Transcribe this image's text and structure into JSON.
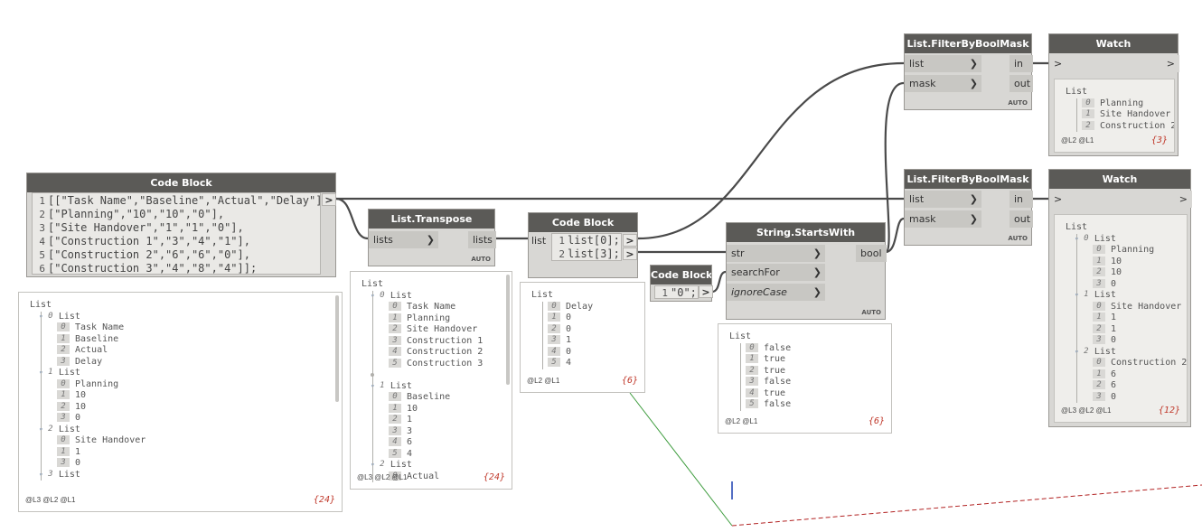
{
  "nodes": {
    "code_main": {
      "title": "Code Block",
      "lines": [
        {
          "n": "1",
          "t": "[[\"Task Name\",\"Baseline\",\"Actual\",\"Delay\"],"
        },
        {
          "n": "2",
          "t": "[\"Planning\",\"10\",\"10\",\"0\"],"
        },
        {
          "n": "3",
          "t": "[\"Site Handover\",\"1\",\"1\",\"0\"],"
        },
        {
          "n": "4",
          "t": "[\"Construction 1\",\"3\",\"4\",\"1\"],"
        },
        {
          "n": "5",
          "t": "[\"Construction 2\",\"6\",\"6\",\"0\"],"
        },
        {
          "n": "6",
          "t": "[\"Construction 3\",\"4\",\"8\",\"4\"]];"
        }
      ],
      "out": ">"
    },
    "transpose": {
      "title": "List.Transpose",
      "in_lists": "lists",
      "out_lists": "lists",
      "auto": "AUTO"
    },
    "code_index": {
      "title": "Code Block",
      "in": "list",
      "lines": [
        {
          "n": "1",
          "t": "list[0];"
        },
        {
          "n": "2",
          "t": "list[3];"
        }
      ],
      "out": ">"
    },
    "code_zero": {
      "title": "Code Block",
      "line_n": "1",
      "line_t": "\"0\";",
      "out": ">"
    },
    "startswith": {
      "title": "String.StartsWith",
      "in_str": "str",
      "in_search": "searchFor",
      "in_ignore": "ignoreCase",
      "out_bool": "bool",
      "auto": "AUTO"
    },
    "filter_top": {
      "title": "List.FilterByBoolMask",
      "in_list": "list",
      "in_mask": "mask",
      "out_in": "in",
      "out_out": "out",
      "auto": "AUTO"
    },
    "filter_bottom": {
      "title": "List.FilterByBoolMask",
      "in_list": "list",
      "in_mask": "mask",
      "out_in": "in",
      "out_out": "out",
      "auto": "AUTO"
    },
    "watch_top": {
      "title": "Watch",
      "in": ">",
      "out": ">"
    },
    "watch_bottom": {
      "title": "Watch",
      "in": ">",
      "out": ">"
    }
  },
  "previews": {
    "code_main": {
      "levels": "@L3 @L2 @L1",
      "count": "{24}",
      "rows": [
        {
          "d": 0,
          "t": "List"
        },
        {
          "d": 1,
          "i": "0",
          "t": "List",
          "g": true
        },
        {
          "d": 2,
          "i": "0",
          "t": "Task Name"
        },
        {
          "d": 2,
          "i": "1",
          "t": "Baseline"
        },
        {
          "d": 2,
          "i": "2",
          "t": "Actual"
        },
        {
          "d": 2,
          "i": "3",
          "t": "Delay"
        },
        {
          "d": 1,
          "i": "1",
          "t": "List",
          "g": true
        },
        {
          "d": 2,
          "i": "0",
          "t": "Planning"
        },
        {
          "d": 2,
          "i": "1",
          "t": "10"
        },
        {
          "d": 2,
          "i": "2",
          "t": "10"
        },
        {
          "d": 2,
          "i": "3",
          "t": "0"
        },
        {
          "d": 1,
          "i": "2",
          "t": "List",
          "g": true
        },
        {
          "d": 2,
          "i": "0",
          "t": "Site Handover"
        },
        {
          "d": 2,
          "i": "1",
          "t": "1"
        },
        {
          "d": 2,
          "i": "3",
          "t": "0"
        },
        {
          "d": 1,
          "i": "3",
          "t": "List",
          "g": true
        }
      ]
    },
    "transpose": {
      "levels": "@L3 @L2 @L1",
      "count": "{24}",
      "rows": [
        {
          "d": 0,
          "t": "List"
        },
        {
          "d": 1,
          "i": "0",
          "t": "List",
          "g": true
        },
        {
          "d": 2,
          "i": "0",
          "t": "Task Name"
        },
        {
          "d": 2,
          "i": "1",
          "t": "Planning"
        },
        {
          "d": 2,
          "i": "2",
          "t": "Site Handover"
        },
        {
          "d": 2,
          "i": "3",
          "t": "Construction 1"
        },
        {
          "d": 2,
          "i": "4",
          "t": "Construction 2"
        },
        {
          "d": 2,
          "i": "5",
          "t": "Construction 3"
        },
        {
          "d": -1,
          "t": ""
        },
        {
          "d": 1,
          "i": "1",
          "t": "List",
          "g": true
        },
        {
          "d": 2,
          "i": "0",
          "t": "Baseline"
        },
        {
          "d": 2,
          "i": "1",
          "t": "10"
        },
        {
          "d": 2,
          "i": "2",
          "t": "1"
        },
        {
          "d": 2,
          "i": "3",
          "t": "3"
        },
        {
          "d": 2,
          "i": "4",
          "t": "6"
        },
        {
          "d": 2,
          "i": "5",
          "t": "4"
        },
        {
          "d": 1,
          "i": "2",
          "t": "List",
          "g": true
        },
        {
          "d": 2,
          "i": "0",
          "t": "Actual"
        }
      ]
    },
    "code_index": {
      "levels": "@L2 @L1",
      "count": "{6}",
      "rows": [
        {
          "d": 0,
          "t": "List"
        },
        {
          "d": 1,
          "i": "0",
          "t": "Delay"
        },
        {
          "d": 1,
          "i": "1",
          "t": "0"
        },
        {
          "d": 1,
          "i": "2",
          "t": "0"
        },
        {
          "d": 1,
          "i": "3",
          "t": "1"
        },
        {
          "d": 1,
          "i": "4",
          "t": "0"
        },
        {
          "d": 1,
          "i": "5",
          "t": "4"
        }
      ]
    },
    "startswith": {
      "levels": "@L2 @L1",
      "count": "{6}",
      "rows": [
        {
          "d": 0,
          "t": "List"
        },
        {
          "d": 1,
          "i": "0",
          "t": "false"
        },
        {
          "d": 1,
          "i": "1",
          "t": "true"
        },
        {
          "d": 1,
          "i": "2",
          "t": "true"
        },
        {
          "d": 1,
          "i": "3",
          "t": "false"
        },
        {
          "d": 1,
          "i": "4",
          "t": "true"
        },
        {
          "d": 1,
          "i": "5",
          "t": "false"
        }
      ]
    },
    "watch_top": {
      "levels": "@L2 @L1",
      "count": "{3}",
      "rows": [
        {
          "d": 0,
          "t": "List"
        },
        {
          "d": 1,
          "i": "0",
          "t": "Planning"
        },
        {
          "d": 1,
          "i": "1",
          "t": "Site Handover"
        },
        {
          "d": 1,
          "i": "2",
          "t": "Construction 2"
        }
      ]
    },
    "watch_bottom": {
      "levels": "@L3 @L2 @L1",
      "count": "{12}",
      "rows": [
        {
          "d": 0,
          "t": "List"
        },
        {
          "d": 1,
          "i": "0",
          "t": "List",
          "g": true
        },
        {
          "d": 2,
          "i": "0",
          "t": "Planning"
        },
        {
          "d": 2,
          "i": "1",
          "t": "10"
        },
        {
          "d": 2,
          "i": "2",
          "t": "10"
        },
        {
          "d": 2,
          "i": "3",
          "t": "0"
        },
        {
          "d": 1,
          "i": "1",
          "t": "List",
          "g": true
        },
        {
          "d": 2,
          "i": "0",
          "t": "Site Handover"
        },
        {
          "d": 2,
          "i": "1",
          "t": "1"
        },
        {
          "d": 2,
          "i": "2",
          "t": "1"
        },
        {
          "d": 2,
          "i": "3",
          "t": "0"
        },
        {
          "d": 1,
          "i": "2",
          "t": "List",
          "g": true
        },
        {
          "d": 2,
          "i": "0",
          "t": "Construction 2"
        },
        {
          "d": 2,
          "i": "1",
          "t": "6"
        },
        {
          "d": 2,
          "i": "2",
          "t": "6"
        },
        {
          "d": 2,
          "i": "3",
          "t": "0"
        }
      ]
    }
  },
  "colors": {
    "wire": "#4a4a4a",
    "header": "#5b5a57",
    "node": "#d8d7d4",
    "count": "#c0392b",
    "selection": "#b22222"
  }
}
